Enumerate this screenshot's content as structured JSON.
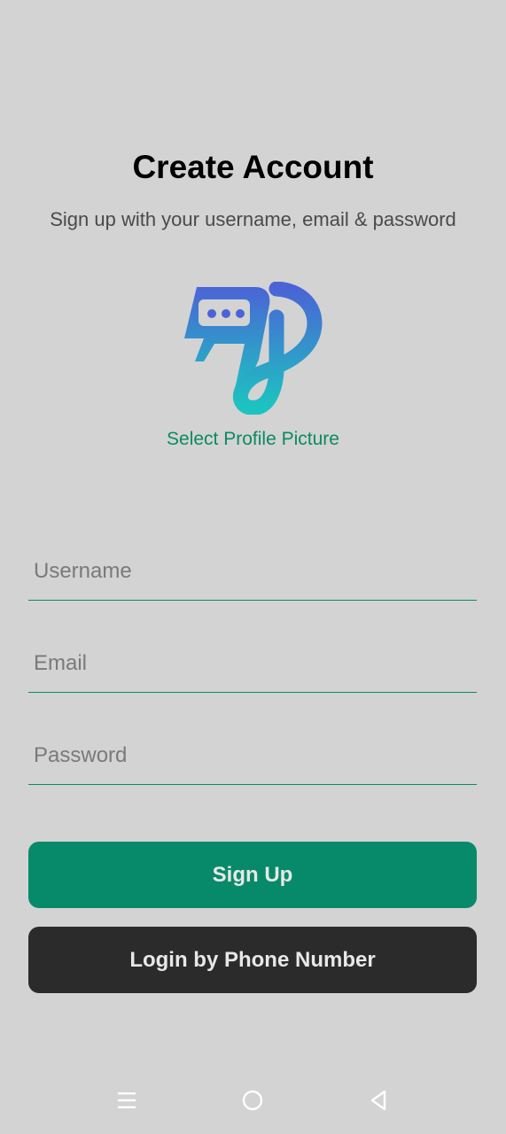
{
  "header": {
    "title": "Create Account",
    "subtitle": "Sign up with your username, email & password"
  },
  "logo": {
    "icon": "chat-bubble-logo-icon",
    "gradient_top": "#4a64d6",
    "gradient_bottom": "#1cc4c0"
  },
  "profile": {
    "select_label": "Select Profile Picture"
  },
  "form": {
    "username": {
      "placeholder": "Username",
      "value": ""
    },
    "email": {
      "placeholder": "Email",
      "value": ""
    },
    "password": {
      "placeholder": "Password",
      "value": ""
    }
  },
  "actions": {
    "signup_label": "Sign Up",
    "phone_login_label": "Login by Phone Number"
  },
  "navbar": {
    "items": [
      {
        "icon": "menu-icon"
      },
      {
        "icon": "home-circle-icon"
      },
      {
        "icon": "back-triangle-icon"
      }
    ]
  },
  "colors": {
    "background": "#d3d3d3",
    "accent": "#078a69",
    "dark_button": "#2b2b2b"
  }
}
